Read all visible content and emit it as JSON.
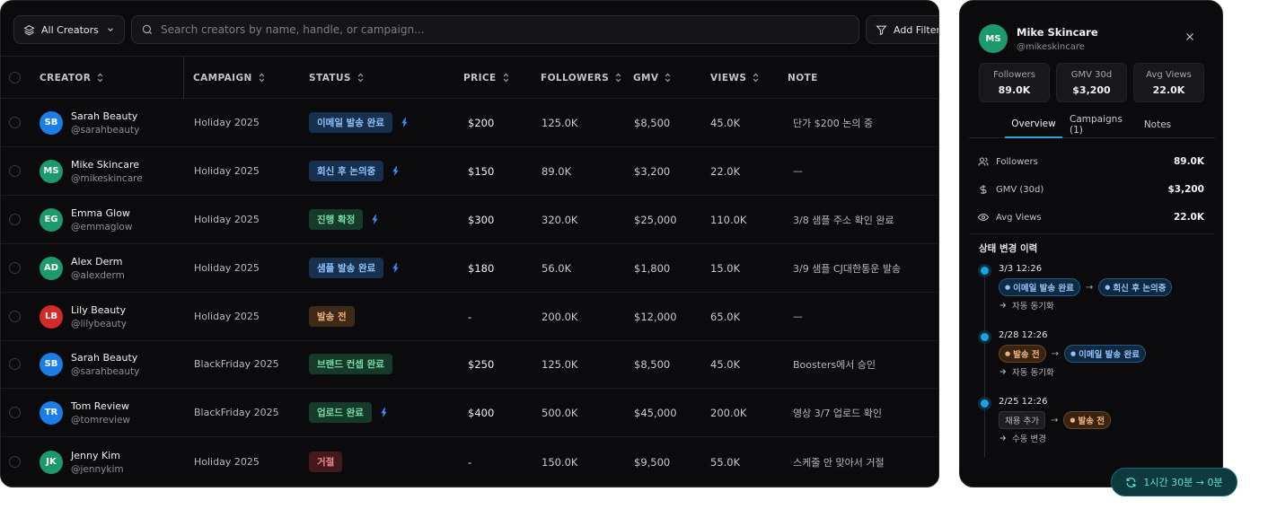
{
  "toolbar": {
    "creators_label": "All Creators",
    "search_placeholder": "Search creators by name, handle, or campaign...",
    "filter_label": "Add Filter"
  },
  "columns": [
    "CREATOR",
    "CAMPAIGN",
    "STATUS",
    "PRICE",
    "FOLLOWERS",
    "GMV",
    "VIEWS",
    "NOTE"
  ],
  "rows": [
    {
      "initials": "SB",
      "avatar_color": "#1a7ee6",
      "name": "Sarah Beauty",
      "handle": "@sarahbeauty",
      "campaign": "Holiday 2025",
      "status": "이메일 발송 완료",
      "status_color": "blue",
      "synced": true,
      "price": "$200",
      "followers": "125.0K",
      "gmv": "$8,500",
      "views": "45.0K",
      "note": "단가 $200 논의 중"
    },
    {
      "initials": "MS",
      "avatar_color": "#1d9a6c",
      "name": "Mike Skincare",
      "handle": "@mikeskincare",
      "campaign": "Holiday 2025",
      "status": "회신 후 논의중",
      "status_color": "blue",
      "synced": true,
      "price": "$150",
      "followers": "89.0K",
      "gmv": "$3,200",
      "views": "22.0K",
      "note": "—"
    },
    {
      "initials": "EG",
      "avatar_color": "#1d9a6c",
      "name": "Emma Glow",
      "handle": "@emmaglow",
      "campaign": "Holiday 2025",
      "status": "진행 확정",
      "status_color": "green",
      "synced": true,
      "price": "$300",
      "followers": "320.0K",
      "gmv": "$25,000",
      "views": "110.0K",
      "note": "3/8 샘플 주소 확인 완료"
    },
    {
      "initials": "AD",
      "avatar_color": "#1d9a6c",
      "name": "Alex Derm",
      "handle": "@alexderm",
      "campaign": "Holiday 2025",
      "status": "샘플 발송 완료",
      "status_color": "blue",
      "synced": true,
      "price": "$180",
      "followers": "56.0K",
      "gmv": "$1,800",
      "views": "15.0K",
      "note": "3/9 샘플 CJ대한통운 발송"
    },
    {
      "initials": "LB",
      "avatar_color": "#d42a2a",
      "name": "Lily Beauty",
      "handle": "@lilybeauty",
      "campaign": "Holiday 2025",
      "status": "발송 전",
      "status_color": "orange",
      "synced": false,
      "price": "-",
      "followers": "200.0K",
      "gmv": "$12,000",
      "views": "65.0K",
      "note": "—"
    },
    {
      "initials": "SB",
      "avatar_color": "#1a7ee6",
      "name": "Sarah Beauty",
      "handle": "@sarahbeauty",
      "campaign": "BlackFriday 2025",
      "status": "브랜드 컨셉 완료",
      "status_color": "green",
      "synced": false,
      "price": "$250",
      "followers": "125.0K",
      "gmv": "$8,500",
      "views": "45.0K",
      "note": "Boosters에서 승인"
    },
    {
      "initials": "TR",
      "avatar_color": "#1a7ee6",
      "name": "Tom Review",
      "handle": "@tomreview",
      "campaign": "BlackFriday 2025",
      "status": "업로드 완료",
      "status_color": "green",
      "synced": true,
      "price": "$400",
      "followers": "500.0K",
      "gmv": "$45,000",
      "views": "200.0K",
      "note": "영상 3/7 업로드 확인"
    },
    {
      "initials": "JK",
      "avatar_color": "#1d9a6c",
      "name": "Jenny Kim",
      "handle": "@jennykim",
      "campaign": "Holiday 2025",
      "status": "거절",
      "status_color": "red",
      "synced": false,
      "price": "-",
      "followers": "150.0K",
      "gmv": "$9,500",
      "views": "55.0K",
      "note": "스케줄 안 맞아서 거절"
    }
  ],
  "panel": {
    "initials": "MS",
    "name": "Mike Skincare",
    "handle": "@mikeskincare",
    "stats": [
      {
        "label": "Followers",
        "value": "89.0K"
      },
      {
        "label": "GMV 30d",
        "value": "$3,200"
      },
      {
        "label": "Avg Views",
        "value": "22.0K"
      }
    ],
    "tabs": [
      "Overview",
      "Campaigns (1)",
      "Notes"
    ],
    "active_tab": "Overview",
    "info": [
      {
        "icon": "users-icon",
        "label": "Followers",
        "value": "89.0K"
      },
      {
        "icon": "dollar-icon",
        "label": "GMV (30d)",
        "value": "$3,200"
      },
      {
        "icon": "eye-icon",
        "label": "Avg Views",
        "value": "22.0K"
      }
    ],
    "history_title": "상태 변경 이력",
    "history": [
      {
        "time": "3/3 12:26",
        "from": "이메일 발송 완료",
        "from_style": "blue",
        "to": "회신 후 논의중",
        "to_style": "blue",
        "source": "자동 동기화"
      },
      {
        "time": "2/28 12:26",
        "from": "발송 전",
        "from_style": "orange",
        "to": "이메일 발송 완료",
        "to_style": "blue",
        "source": "자동 동기화"
      },
      {
        "time": "2/25 12:26",
        "from": "채용 추가",
        "from_style": "gray",
        "to": "발송 전",
        "to_style": "orange",
        "source": "수동 변경"
      }
    ]
  },
  "toast": {
    "label": "1시간 30분 → 0분"
  }
}
